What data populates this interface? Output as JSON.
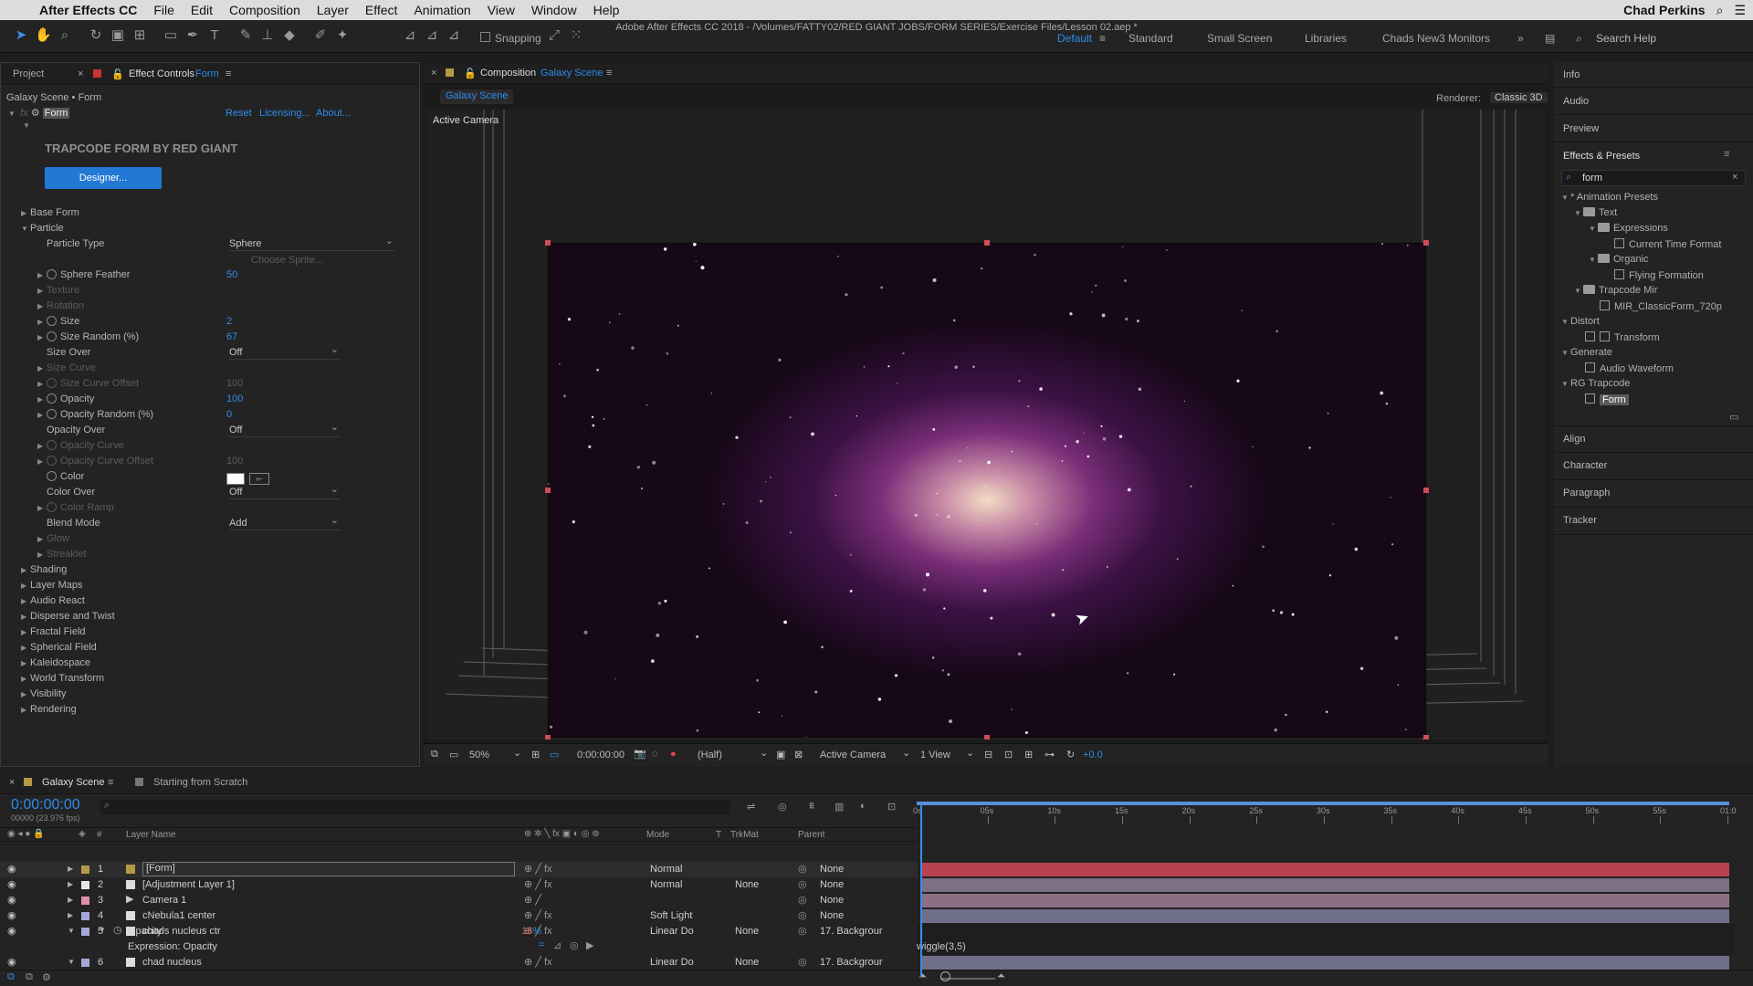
{
  "menubar": {
    "apple": "",
    "app_name": "After Effects CC",
    "items": [
      "File",
      "Edit",
      "Composition",
      "Layer",
      "Effect",
      "Animation",
      "View",
      "Window",
      "Help"
    ],
    "window_title": "Adobe After Effects CC 2018 - /Volumes/FATTY02/RED GIANT JOBS/FORM SERIES/Exercise Files/Lesson 02.aep *",
    "user": "Chad Perkins"
  },
  "toolbar": {
    "snapping_label": "Snapping",
    "workspaces": [
      "Default",
      "Standard",
      "Small Screen",
      "Libraries",
      "Chads New3 Monitors"
    ],
    "active_workspace": "Default",
    "search_placeholder": "Search Help"
  },
  "effect_controls": {
    "tab_project": "Project",
    "tab_effect_controls": "Effect Controls",
    "tab_effect_name": "Form",
    "breadcrumb": "Galaxy Scene • Form",
    "fx_name": "Form",
    "reset": "Reset",
    "licensing": "Licensing...",
    "about": "About...",
    "header": "TRAPCODE FORM BY RED GIANT",
    "designer_button": "Designer...",
    "base_form": "Base Form",
    "particle": "Particle",
    "particle_type_label": "Particle Type",
    "particle_type_value": "Sphere",
    "choose_sprite": "Choose Sprite...",
    "sphere_feather_label": "Sphere Feather",
    "sphere_feather_value": "50",
    "texture": "Texture",
    "rotation": "Rotation",
    "size_label": "Size",
    "size_value": "2",
    "size_random_label": "Size Random (%)",
    "size_random_value": "67",
    "size_over_label": "Size Over",
    "size_over_value": "Off",
    "size_curve": "Size Curve",
    "size_curve_offset_label": "Size Curve Offset",
    "size_curve_offset_value": "100",
    "opacity_label": "Opacity",
    "opacity_value": "100",
    "opacity_random_label": "Opacity Random (%)",
    "opacity_random_value": "0",
    "opacity_over_label": "Opacity Over",
    "opacity_over_value": "Off",
    "opacity_curve": "Opacity Curve",
    "opacity_curve_offset_label": "Opacity Curve Offset",
    "opacity_curve_offset_value": "100",
    "color_label": "Color",
    "color_swatch": "#ffffff",
    "color_over_label": "Color Over",
    "color_over_value": "Off",
    "color_ramp": "Color Ramp",
    "blend_mode_label": "Blend Mode",
    "blend_mode_value": "Add",
    "glow": "Glow",
    "streaklet": "Streaklet",
    "groups": [
      "Shading",
      "Layer Maps",
      "Audio React",
      "Disperse and Twist",
      "Fractal Field",
      "Spherical Field",
      "Kaleidospace",
      "World Transform",
      "Visibility",
      "Rendering"
    ]
  },
  "composition": {
    "tab_prefix": "Composition",
    "tab_name": "Galaxy Scene",
    "sub_tab": "Galaxy Scene",
    "renderer_label": "Renderer:",
    "renderer_value": "Classic 3D",
    "active_camera_label": "Active Camera",
    "footer": {
      "zoom": "50%",
      "timecode": "0:00:00:00",
      "resolution": "(Half)",
      "camera": "Active Camera",
      "views": "1 View",
      "exposure": "+0.0"
    }
  },
  "right_panel": {
    "info": "Info",
    "audio": "Audio",
    "preview": "Preview",
    "effects_presets": "Effects & Presets",
    "search_value": "form",
    "tree": [
      {
        "label": "* Animation Presets",
        "kind": "group"
      },
      {
        "label": "Text",
        "kind": "folder"
      },
      {
        "label": "Expressions",
        "kind": "folder"
      },
      {
        "label": "Current Time Format",
        "kind": "preset"
      },
      {
        "label": "Organic",
        "kind": "folder"
      },
      {
        "label": "Flying Formation",
        "kind": "preset"
      },
      {
        "label": "Trapcode Mir",
        "kind": "folder"
      },
      {
        "label": "MIR_ClassicForm_720p",
        "kind": "preset"
      },
      {
        "label": "Distort",
        "kind": "group"
      },
      {
        "label": "Transform",
        "kind": "effect"
      },
      {
        "label": "Generate",
        "kind": "group"
      },
      {
        "label": "Audio Waveform",
        "kind": "effect"
      },
      {
        "label": "RG Trapcode",
        "kind": "group"
      },
      {
        "label": "Form",
        "kind": "effect"
      }
    ],
    "align": "Align",
    "character": "Character",
    "paragraph": "Paragraph",
    "tracker": "Tracker"
  },
  "timeline": {
    "tab_active": "Galaxy Scene",
    "tab_other": "Starting from Scratch",
    "timecode": "0:00:00:00",
    "fps": "00000 (23.976 fps)",
    "col_layer_name": "Layer Name",
    "col_mode": "Mode",
    "col_t": "T",
    "col_trkmat": "TrkMat",
    "col_parent": "Parent",
    "ruler": [
      "0s",
      "05s",
      "10s",
      "15s",
      "20s",
      "25s",
      "30s",
      "35s",
      "40s",
      "45s",
      "50s",
      "55s",
      "01:0"
    ],
    "layers": [
      {
        "num": "1",
        "name": "[Form]",
        "mode": "Normal",
        "trkmat": "",
        "parent": "None",
        "label_color": "#b59a45",
        "bar_color": "#b8434f"
      },
      {
        "num": "2",
        "name": "[Adjustment Layer 1]",
        "mode": "Normal",
        "trkmat": "None",
        "parent": "None",
        "label_color": "#e6e6e6",
        "bar_color": "#7c6f86"
      },
      {
        "num": "3",
        "name": "Camera 1",
        "mode": "",
        "trkmat": "",
        "parent": "None",
        "label_color": "#e28ea6",
        "bar_color": "#8c6f85"
      },
      {
        "num": "4",
        "name": "cNebula1 center",
        "mode": "Soft Light",
        "trkmat": "",
        "parent": "None",
        "label_color": "#a6a7d6",
        "bar_color": "#6f6f8a"
      },
      {
        "num": "5",
        "name": "chads nucleus ctr",
        "mode": "Linear Do",
        "trkmat": "None",
        "parent": "17. Backgrour",
        "label_color": "#a6a7d6",
        "bar_color": "#6f6f8a"
      },
      {
        "num": "6",
        "name": "chad nucleus",
        "mode": "Linear Do",
        "trkmat": "None",
        "parent": "17. Backgrour",
        "label_color": "#a6a7d6",
        "bar_color": "#6f6f8a"
      }
    ],
    "opacity_prop": "Opacity",
    "opacity_value": "16",
    "opacity_unit": "%",
    "expression_label": "Expression: Opacity",
    "expression_code": "wiggle(3,5)"
  }
}
